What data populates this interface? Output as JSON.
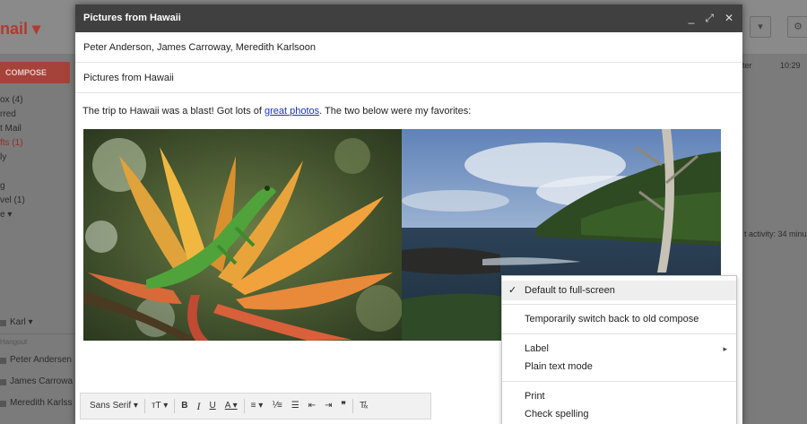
{
  "background": {
    "logo": "nail ▾",
    "compose_button": "COMPOSE",
    "nav": [
      {
        "label": "ox (4)",
        "red": false
      },
      {
        "label": "rred",
        "red": false
      },
      {
        "label": "t Mail",
        "red": false
      },
      {
        "label": "fts (1)",
        "red": true
      },
      {
        "label": "ly",
        "red": false
      },
      {
        "label": "",
        "red": false
      },
      {
        "label": "g",
        "red": false
      },
      {
        "label": "vel (1)",
        "red": false
      },
      {
        "label": "e ▾",
        "red": false
      }
    ],
    "hangout_user": "Karl ▾",
    "hangout_search": "Hangout",
    "hangout_contacts": [
      "Peter Andersen",
      "James Carrowa",
      "Meredith Karlss"
    ],
    "right_texts": [
      "ter",
      "10:29",
      "t activity: 34 minu"
    ]
  },
  "compose": {
    "title": "Pictures from Hawaii",
    "controls": {
      "minimize": "_",
      "expand": "⤢",
      "close": "✕"
    },
    "to": "Peter Anderson, James Carroway, Meredith Karlsoon",
    "subject": "Pictures from Hawaii",
    "body_before_link": "The trip to Hawaii was a blast!  Got lots of ",
    "body_link": "great photos",
    "body_after_link": ".  The two below were my favorites:",
    "toolbar": {
      "font": "Sans Serif ▾",
      "size": "тT ▾",
      "bold": "B",
      "italic": "I",
      "underline": "U",
      "text_color": "A ▾",
      "align": "≡ ▾",
      "numbered_list": "⅟≡",
      "bulleted_list": "☰",
      "indent_less": "⇤",
      "indent_more": "⇥",
      "quote": "❞",
      "clear_format": "T̸ₓ"
    }
  },
  "menu": {
    "check": "✓",
    "items": {
      "default_full_screen": "Default to full-screen",
      "switch_old": "Temporarily switch back to old compose",
      "label": "Label",
      "label_arrow": "▸",
      "plain_text": "Plain text mode",
      "print": "Print",
      "spelling": "Check spelling"
    }
  }
}
